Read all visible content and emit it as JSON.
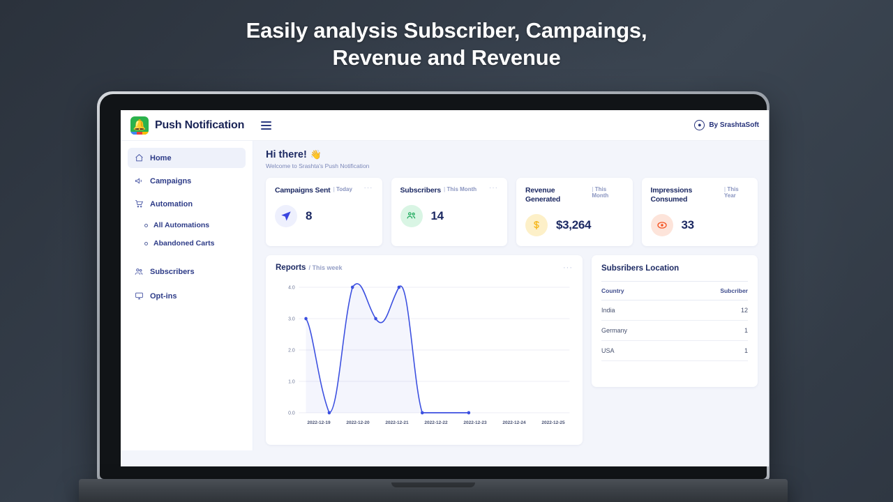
{
  "headline": {
    "line1": "Easily analysis Subscriber, Campaings,",
    "line2": "Revenue and Revenue"
  },
  "header": {
    "brand": "Push Notification",
    "logo_icon": "bell-icon",
    "menu_icon": "hamburger-icon",
    "user_icon": "user-circle-icon",
    "user_label": "By SrashtaSoft"
  },
  "sidebar": {
    "items": [
      {
        "label": "Home",
        "icon": "home-icon",
        "active": true
      },
      {
        "label": "Campaigns",
        "icon": "megaphone-icon",
        "active": false
      },
      {
        "label": "Automation",
        "icon": "cart-icon",
        "active": false
      }
    ],
    "sub_items": [
      {
        "label": "All Automations"
      },
      {
        "label": "Abandoned Carts"
      }
    ],
    "items_bottom": [
      {
        "label": "Subscribers",
        "icon": "users-icon",
        "active": false
      },
      {
        "label": "Opt-ins",
        "icon": "monitor-icon",
        "active": false
      }
    ]
  },
  "main": {
    "greeting": "Hi there!",
    "greeting_emoji": "👋",
    "welcome": "Welcome to Srashta's Push Notification",
    "cards": [
      {
        "title": "Campaigns Sent",
        "period": "Today",
        "value": "8",
        "icon": "send-icon",
        "icon_color": "#3b46e0",
        "icon_bg": "#eef0fd",
        "menu": "···"
      },
      {
        "title": "Subscribers",
        "period": "This Month",
        "value": "14",
        "icon": "users-group-icon",
        "icon_color": "#1aa85a",
        "icon_bg": "#d9f5e4",
        "menu": "···"
      },
      {
        "title": "Revenue Generated",
        "period": "This Month",
        "value": "$3,264",
        "icon": "dollar-icon",
        "icon_color": "#f5b820",
        "icon_bg": "#fdf0c8",
        "menu": "···"
      },
      {
        "title": "Impressions Consumed",
        "period": "This Year",
        "value": "33",
        "icon": "eye-icon",
        "icon_color": "#f4501e",
        "icon_bg": "#fde4da",
        "menu": "···"
      }
    ],
    "report": {
      "title": "Reports",
      "subtitle": "/ This week",
      "menu": "···"
    },
    "location": {
      "title": "Subsribers Location",
      "columns": [
        "Country",
        "Subcriber"
      ],
      "rows": [
        {
          "country": "India",
          "subscribers": "12"
        },
        {
          "country": "Germany",
          "subscribers": "1"
        },
        {
          "country": "USA",
          "subscribers": "1"
        }
      ]
    }
  },
  "chart_data": {
    "type": "line",
    "title": "Reports",
    "subtitle": "This week",
    "x": [
      "2022-12-19",
      "2022-12-20",
      "2022-12-21",
      "2022-12-22",
      "2022-12-23",
      "2022-12-24",
      "2022-12-25"
    ],
    "values": [
      3.0,
      0.0,
      4.0,
      3.0,
      4.0,
      0.0,
      0.0
    ],
    "yticks": [
      "0.0",
      "1.0",
      "2.0",
      "3.0",
      "4.0"
    ],
    "ylim": [
      0,
      4
    ],
    "xlabel": "",
    "ylabel": "",
    "grid": true,
    "legend": "none",
    "line_color": "#3b4fe0",
    "fill_color": "rgba(59,79,224,0.06)"
  },
  "colors": {
    "accent": "#3b4fe0",
    "text_dark": "#1d2a63",
    "bg_app": "#f3f5fb",
    "page_bg": "#2f3742"
  }
}
